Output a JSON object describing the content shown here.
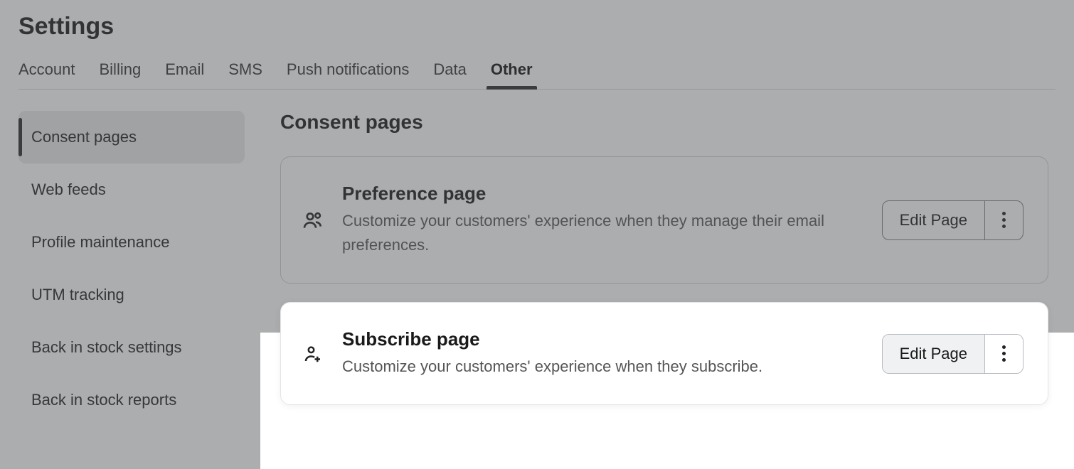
{
  "header": {
    "title": "Settings",
    "tabs": [
      {
        "label": "Account",
        "active": false
      },
      {
        "label": "Billing",
        "active": false
      },
      {
        "label": "Email",
        "active": false
      },
      {
        "label": "SMS",
        "active": false
      },
      {
        "label": "Push notifications",
        "active": false
      },
      {
        "label": "Data",
        "active": false
      },
      {
        "label": "Other",
        "active": true
      }
    ]
  },
  "sidebar": {
    "items": [
      {
        "label": "Consent pages",
        "active": true
      },
      {
        "label": "Web feeds",
        "active": false
      },
      {
        "label": "Profile maintenance",
        "active": false
      },
      {
        "label": "UTM tracking",
        "active": false
      },
      {
        "label": "Back in stock settings",
        "active": false
      },
      {
        "label": "Back in stock reports",
        "active": false
      }
    ]
  },
  "main": {
    "section_title": "Consent pages",
    "cards": [
      {
        "icon": "people-icon",
        "title": "Preference page",
        "desc": "Customize your customers' experience when they manage their email preferences.",
        "edit_label": "Edit Page",
        "highlighted": false
      },
      {
        "icon": "person-plus-icon",
        "title": "Subscribe page",
        "desc": "Customize your customers' experience when they subscribe.",
        "edit_label": "Edit Page",
        "highlighted": true
      }
    ]
  }
}
